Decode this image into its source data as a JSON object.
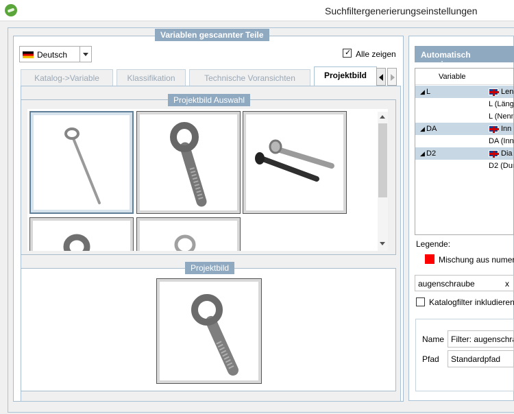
{
  "window": {
    "title": "Suchfiltergenerierungseinstellungen"
  },
  "left_group": {
    "title": "Variablen gescannter Teile",
    "language": "Deutsch",
    "show_all_label": "Alle zeigen",
    "show_all_checked": true,
    "tabs": [
      "Katalog->Variable",
      "Klassifikation",
      "Technische Voransichten",
      "Projektbild"
    ],
    "active_tab": "Projektbild",
    "selection_title": "Projektbild Auswahl",
    "preview_title": "Projektbild"
  },
  "right_panel": {
    "assign_button": "Automatisch zuweisen",
    "grid_header": "Variable",
    "rows": [
      {
        "variable": "L",
        "value": "Len",
        "is_group": true
      },
      {
        "variable": "",
        "value": "L (Läng",
        "is_group": false
      },
      {
        "variable": "",
        "value": "L (Nenn",
        "is_group": false
      },
      {
        "variable": "DA",
        "value": "Inn",
        "is_group": true
      },
      {
        "variable": "",
        "value": "DA (Inn",
        "is_group": false
      },
      {
        "variable": "D2",
        "value": "Dia",
        "is_group": true
      },
      {
        "variable": "",
        "value": "D2 (Dur",
        "is_group": false
      }
    ],
    "legend_label": "Legende:",
    "legend_item": "Mischung aus numer",
    "legend_color": "#ff0000",
    "search_value": "augenschraube",
    "clear_symbol": "x",
    "include_catalog_label": "Katalogfilter inkludieren",
    "include_catalog_checked": false,
    "name_label": "Name",
    "name_value": "Filter: augenschra",
    "path_label": "Pfad",
    "path_value": "Standardpfad"
  }
}
